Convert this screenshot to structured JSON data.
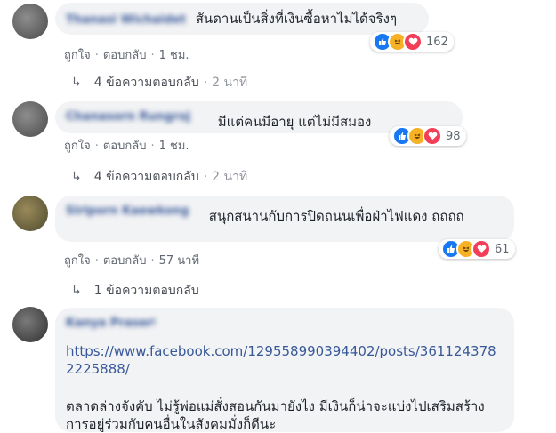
{
  "comments": [
    {
      "author": "Thanasi Wichaidet",
      "text": "สันดานเป็นสิ่งที่เงินซื้อหาไม่ได้จริงๆ",
      "reaction_count": "162",
      "like_label": "ถูกใจ",
      "reply_label": "ตอบกลับ",
      "time": "1 ชม.",
      "replies_label": "4 ข้อความตอบกลับ",
      "replies_time": "2 นาที"
    },
    {
      "author": "Chanasorn Rungroj",
      "text": "มีแต่คนมีอายุ แต่ไม่มีสมอง",
      "reaction_count": "98",
      "like_label": "ถูกใจ",
      "reply_label": "ตอบกลับ",
      "time": "1 ชม.",
      "replies_label": "4 ข้อความตอบกลับ",
      "replies_time": "2 นาที"
    },
    {
      "author": "Siriporn Kaewkong",
      "text": "สนุกสนานกับการปิดถนนเพื่อฝ่าไฟแดง ถถถถ",
      "reaction_count": "61",
      "like_label": "ถูกใจ",
      "reply_label": "ตอบกลับ",
      "time": "57 นาที",
      "replies_label": "1 ข้อความตอบกลับ"
    },
    {
      "author": "Kanya Prasert",
      "link": "https://www.facebook.com/129558990394402/posts/3611243782225888/",
      "text": "ตลาดล่างจังคับ ไม่รู้พ่อแม่สั่งสอนกันมายังไง มีเงินก็น่าจะแบ่งไปเสริมสร้างการอยู่ร่วมกับคนอื่นในสังคมมั่งก็ดีนะ"
    }
  ],
  "colors": {
    "bubble": "#f2f3f5",
    "link": "#385898",
    "meta": "#606770",
    "like": "#1877f2",
    "haha": "#f7b125",
    "love": "#f33e58"
  }
}
